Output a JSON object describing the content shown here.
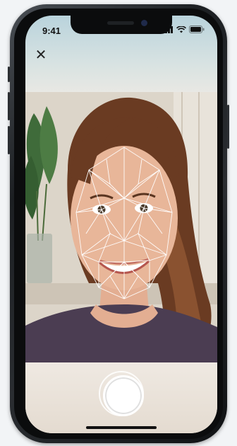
{
  "status_bar": {
    "time": "9:41"
  },
  "controls": {
    "close_label": "✕"
  },
  "colors": {
    "mesh": "#ffffff",
    "shutter": "#ffffff",
    "frame": "#1c1f22"
  },
  "icons": [
    "cellular-signal-icon",
    "wifi-icon",
    "battery-icon",
    "close-icon",
    "shutter-button"
  ]
}
